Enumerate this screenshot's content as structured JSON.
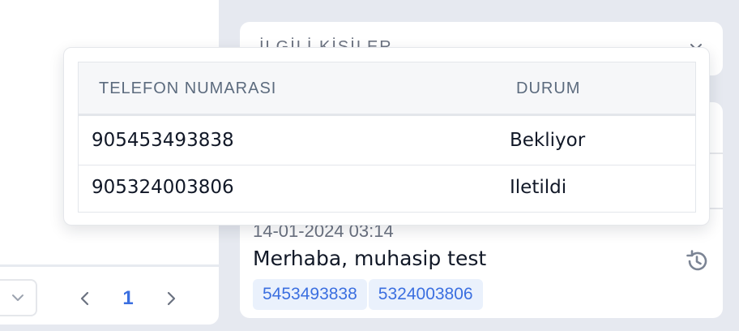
{
  "left_panel": {
    "pagination": {
      "current_page": "1",
      "prev_icon": "chevron-left-icon",
      "next_icon": "chevron-right-icon",
      "page_size_icon": "chevron-down-icon"
    }
  },
  "related_people": {
    "title": "İLGİLİ KİŞİLER",
    "toggle_icon": "chevron-down-icon"
  },
  "message": {
    "date": "14-01-2024 03:14",
    "text": "Merhaba, muhasip test",
    "history_icon": "history-icon",
    "recipients": [
      "5453493838",
      "5324003806"
    ]
  },
  "delivery_popover": {
    "headers": {
      "phone": "TELEFON NUMARASI",
      "status": "DURUM"
    },
    "rows": [
      {
        "phone": "905453493838",
        "status": "Bekliyor"
      },
      {
        "phone": "905324003806",
        "status": "Iletildi"
      }
    ]
  },
  "colors": {
    "accent": "#3b6fe0",
    "background": "#e6e9f0",
    "tag_background": "#eaf1fc"
  }
}
